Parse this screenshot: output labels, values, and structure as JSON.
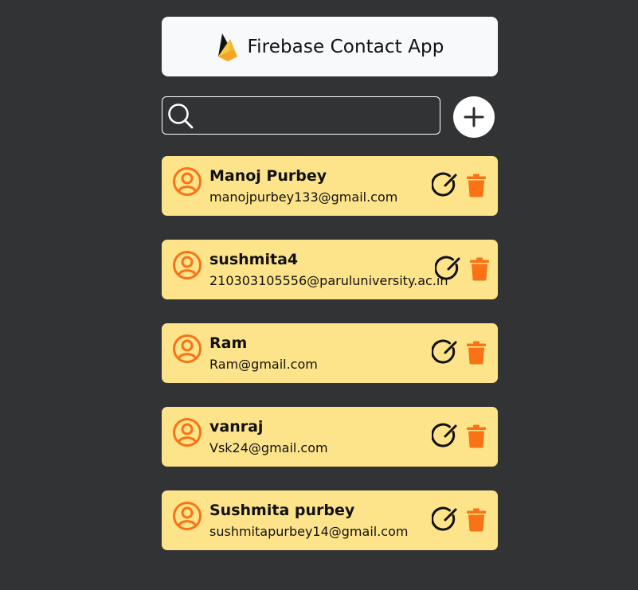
{
  "header": {
    "title": "Firebase Contact App",
    "logo_icon": "firebase-logo-icon"
  },
  "search": {
    "value": "",
    "placeholder": "",
    "icon": "search-icon"
  },
  "add_button": {
    "icon": "plus-icon"
  },
  "colors": {
    "background": "#323334",
    "card": "#fde48b",
    "accent_orange": "#f97316",
    "header_bg": "#f8f9fb"
  },
  "contacts": [
    {
      "name": "Manoj Purbey",
      "email": "manojpurbey133@gmail.com"
    },
    {
      "name": "sushmita4",
      "email": "210303105556@paruluniversity.ac.in"
    },
    {
      "name": "Ram",
      "email": "Ram@gmail.com"
    },
    {
      "name": "vanraj",
      "email": "Vsk24@gmail.com"
    },
    {
      "name": "Sushmita purbey",
      "email": "sushmitapurbey14@gmail.com"
    }
  ]
}
